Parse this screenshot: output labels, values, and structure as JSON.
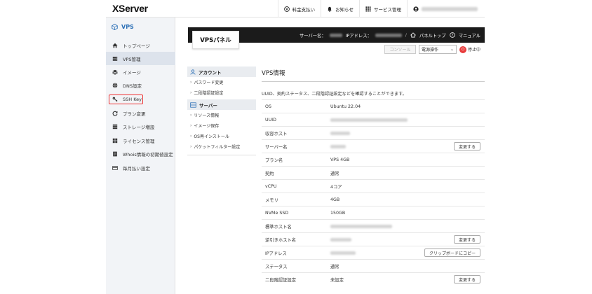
{
  "brand": "XServer",
  "topnav": [
    {
      "label": "料金支払い",
      "icon": "yen-circle-icon"
    },
    {
      "label": "お知らせ",
      "icon": "bell-icon"
    },
    {
      "label": "サービス管理",
      "icon": "grid-icon"
    }
  ],
  "sidebar": {
    "header": "VPS",
    "items": [
      {
        "label": "トップページ",
        "icon": "home-icon"
      },
      {
        "label": "VPS管理",
        "icon": "server-icon",
        "active": true
      },
      {
        "label": "イメージ",
        "icon": "layers-icon"
      },
      {
        "label": "DNS設定",
        "icon": "globe-icon"
      },
      {
        "label": "SSH Key",
        "icon": "key-icon",
        "highlighted": true
      },
      {
        "label": "プラン変更",
        "icon": "refresh-icon"
      },
      {
        "label": "ストレージ増設",
        "icon": "storage-icon"
      },
      {
        "label": "ライセンス管理",
        "icon": "windows-icon"
      },
      {
        "label": "Whois情報の初期値設定",
        "icon": "document-icon"
      },
      {
        "label": "毎月払い設定",
        "icon": "card-icon"
      }
    ]
  },
  "panel": {
    "title": "VPSパネル",
    "server_name_label": "サーバー名：",
    "ip_label": "IPアドレス：",
    "panel_top": "パネルトップ",
    "manual": "マニュアル",
    "console": "コンソール",
    "power_select": "電源操作",
    "status": "停止中"
  },
  "submenu": {
    "account_head": "アカウント",
    "account_items": [
      "パスワード変更",
      "二段階認証設定"
    ],
    "server_head": "サーバー",
    "server_items": [
      "リソース情報",
      "イメージ保存",
      "OS再インストール",
      "パケットフィルター設定"
    ]
  },
  "info": {
    "title": "VPS情報",
    "description": "UUID、契約ステータス、二段階認証設定などを確認することができます。",
    "rows": [
      {
        "label": "OS",
        "value": "Ubuntu 22.04"
      },
      {
        "label": "UUID",
        "value": "",
        "blurred": true
      },
      {
        "label": "収容ホスト",
        "value": "",
        "blurred": true
      },
      {
        "label": "サーバー名",
        "value": "",
        "blurred": true,
        "action": "変更する"
      },
      {
        "label": "プラン名",
        "value": "VPS 4GB"
      },
      {
        "label": "契約",
        "value": "通常"
      },
      {
        "label": "vCPU",
        "value": "4コア"
      },
      {
        "label": "メモリ",
        "value": "4GB"
      },
      {
        "label": "NVMe SSD",
        "value": "150GB"
      },
      {
        "label": "標準ホスト名",
        "value": "",
        "blurred": true
      },
      {
        "label": "逆引きホスト名",
        "value": "",
        "blurred": true,
        "action": "変更する"
      },
      {
        "label": "IPアドレス",
        "value": "",
        "blurred": true,
        "action": "クリップボードにコピー"
      },
      {
        "label": "ステータス",
        "value": "通常"
      },
      {
        "label": "二段階認証設定",
        "value": "未設定",
        "action": "変更する"
      }
    ]
  }
}
